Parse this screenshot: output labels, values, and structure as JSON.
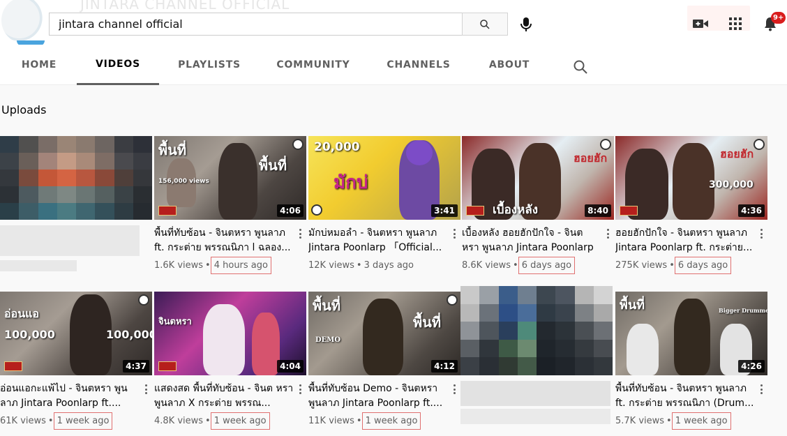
{
  "search": {
    "value": "jintara channel official",
    "ghost_title": "JINTARA CHANNEL OFFICIAL"
  },
  "header": {
    "notifications_badge": "9+"
  },
  "tabs": [
    {
      "label": "HOME",
      "active": false
    },
    {
      "label": "VIDEOS",
      "active": true
    },
    {
      "label": "PLAYLISTS",
      "active": false
    },
    {
      "label": "COMMUNITY",
      "active": false
    },
    {
      "label": "CHANNELS",
      "active": false
    },
    {
      "label": "ABOUT",
      "active": false
    }
  ],
  "section": {
    "title": "Uploads"
  },
  "videos": [
    {
      "title": "",
      "views": "",
      "age": "",
      "duration": "",
      "blurred": true
    },
    {
      "title": "พื้นที่ทับซ้อน - จินตหรา พูนลาภ ft. กระต่าย พรรณนิภา l ฉลอง...",
      "views": "1.6K views",
      "age": "4 hours ago",
      "duration": "4:06",
      "overlay": "156,000 views",
      "boxed": true
    },
    {
      "title": "มักบ่หมอลำ - จินตหรา พูนลาภ Jintara Poonlarp 「Official...",
      "views": "12K views",
      "age": "3 days ago",
      "duration": "3:41",
      "overlay": "20,000",
      "boxed": false
    },
    {
      "title": "เบื้องหลัง ฮอยฮักปักใจ - จินต หรา พูนลาภ Jintara Poonlarp",
      "views": "8.6K views",
      "age": "6 days ago",
      "duration": "8:40",
      "overlay": "เบื้องหลัง",
      "boxed": true
    },
    {
      "title": "ฮอยฮักปักใจ - จินตหรา พูนลาภ Jintara Poonlarp ft. กระต่าย...",
      "views": "275K views",
      "age": "6 days ago",
      "duration": "4:36",
      "overlay": "300,000",
      "boxed": true
    },
    {
      "title": "อ่อนแอกะแพ้ไป - จินตหรา พูน ลาภ Jintara Poonlarp ft....",
      "views": "61K views",
      "age": "1 week ago",
      "duration": "4:37",
      "overlay": "100,000",
      "boxed": true
    },
    {
      "title": "แสดงสด พื้นที่ทับซ้อน - จินต หรา พูนลาภ X กระต่าย พรรณ...",
      "views": "4.8K views",
      "age": "1 week ago",
      "duration": "4:04",
      "overlay": "จินตหรา",
      "boxed": true
    },
    {
      "title": "พื้นที่ทับซ้อน Demo - จินตหรา พูนลาภ Jintara Poonlarp ft....",
      "views": "11K views",
      "age": "1 week ago",
      "duration": "4:12",
      "overlay": "DEMO",
      "boxed": true
    },
    {
      "title": "",
      "views": "",
      "age": "",
      "duration": "",
      "blurred": true
    },
    {
      "title": "พื้นที่ทับซ้อน - จินตหรา พูนลาภ ft. กระต่าย พรรณนิภา (Drum...",
      "views": "5.7K views",
      "age": "1 week ago",
      "duration": "4:26",
      "overlay": "Bigger Drummer",
      "boxed": true
    }
  ],
  "colors": {
    "tab_active_underline": "#606060",
    "highlight_box": "#e07070",
    "badge": "#d91d1d"
  },
  "icons": [
    "search-icon",
    "mic-icon",
    "video-camera-icon",
    "apps-grid-icon",
    "bell-icon",
    "more-vert-icon"
  ]
}
